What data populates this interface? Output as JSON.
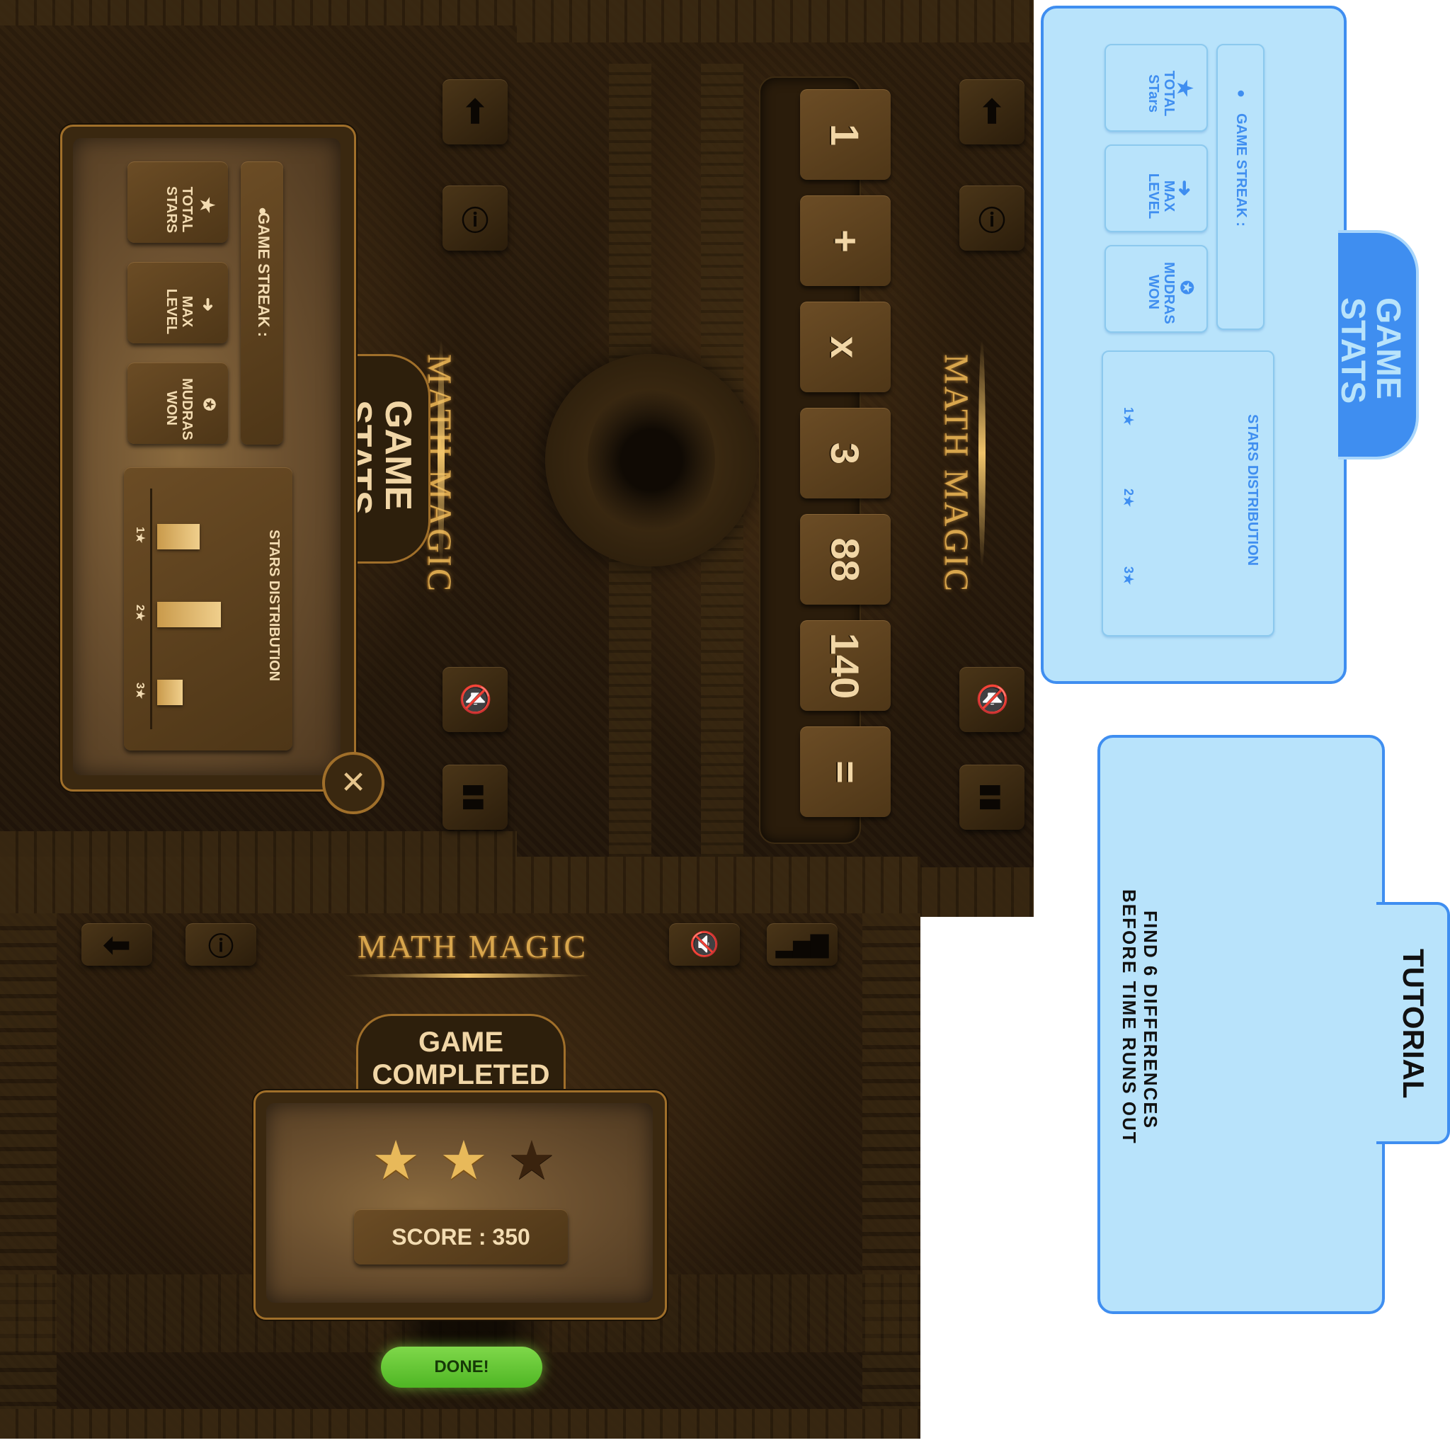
{
  "colors": {
    "gold": "#d8a64d",
    "parchment": "#6d5130",
    "dark_bg": "#2c1d0c",
    "blue_accent": "#3f8ef0",
    "blue_fill": "#b8e3fb",
    "done_green": "#68c83a",
    "bar_gold": "#e9c277"
  },
  "app": {
    "logo": "MATH MAGIC"
  },
  "icons": {
    "back": "arrow-up-icon",
    "info": "info-icon",
    "mute": "speaker-mute-icon",
    "stats": "bar-chart-icon",
    "close": "close-icon",
    "star": "star-icon",
    "flame": "flame-icon",
    "arrow": "arrow-up-icon",
    "medal": "medal-icon"
  },
  "stats_panel": {
    "title": "GAME STATS",
    "streak_label": "GAME STREAK :",
    "tiles": [
      {
        "label": "TOTAL STARS",
        "icon": "star-icon"
      },
      {
        "label": "MAX LEVEL",
        "icon": "arrow-up-icon"
      },
      {
        "label": "MUDRAS WON",
        "icon": "medal-icon"
      }
    ],
    "distribution_title": "STARS DISTRIBUTION",
    "distribution": [
      {
        "label": "1★",
        "fraction": 0.3
      },
      {
        "label": "2★",
        "fraction": 0.45
      },
      {
        "label": "3★",
        "fraction": 0.18
      }
    ]
  },
  "equation": {
    "tiles": [
      "1",
      "+",
      "x",
      "3",
      "88",
      "140",
      "="
    ]
  },
  "completed": {
    "title_line1": "GAME",
    "title_line2": "COMPLETED",
    "stars_earned": 2,
    "stars_total": 3,
    "score": "SCORE : 350",
    "done_button": "DONE!"
  },
  "blue_stats": {
    "title": "GAME STATS",
    "streak_label": "GAME STREAK :",
    "tiles": [
      {
        "label": "TOTAL STars",
        "icon": "star-icon"
      },
      {
        "label": "MAX LEVEL",
        "icon": "arrow-up-icon"
      },
      {
        "label": "MUDRAS WON",
        "icon": "medal-icon"
      }
    ],
    "distribution_title": "STARS DISTRIBUTION",
    "distribution_labels": [
      "1★",
      "2★",
      "3★"
    ]
  },
  "tutorial": {
    "title": "TUTORIAL",
    "line1": "FIND 6 DIFFERENCES",
    "line2": "BEFORE TIME RUNS OUT"
  }
}
